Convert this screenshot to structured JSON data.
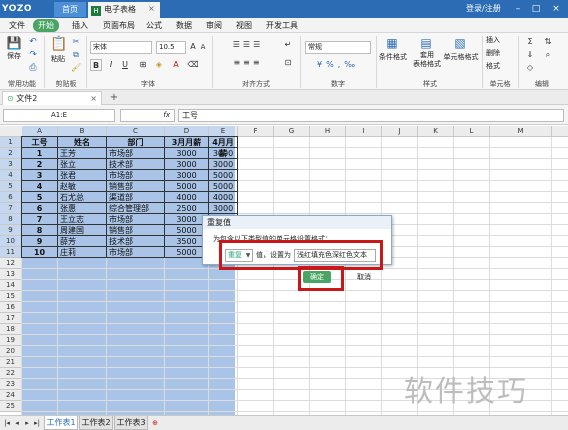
{
  "titlebar": {
    "logo": "YOZO",
    "home_tab": "首页",
    "doc_tab": "电子表格",
    "doc_tab_icon": "H",
    "login": "登录/注册"
  },
  "menu": [
    "文件",
    "开始",
    "插入",
    "页面布局",
    "公式",
    "数据",
    "审阅",
    "视图",
    "开发工具"
  ],
  "ribbon": {
    "save": "保存",
    "paste": "粘贴",
    "font_name": "宋体",
    "font_size": "10.5",
    "number_format": "常规",
    "conditional_format": "条件格式",
    "table_format": "套用\n表格格式",
    "cell_format": "单元格格式",
    "insert": "插入",
    "delete": "删除",
    "format": "格式",
    "bold": "B",
    "italic": "I",
    "underline": "U",
    "groups": [
      "常用功能",
      "剪贴板",
      "字体",
      "对齐方式",
      "数字",
      "样式",
      "单元格",
      "编辑"
    ]
  },
  "doc_tabrow": {
    "tab_label": "文件2",
    "tab_close": "×",
    "new_tab": "+"
  },
  "formula_bar": {
    "name_box": "A1:E",
    "fx": "fx",
    "content": "工号"
  },
  "grid": {
    "columns": [
      "A",
      "B",
      "C",
      "D",
      "E",
      "F",
      "G",
      "H",
      "I",
      "J",
      "K",
      "L",
      "M"
    ],
    "rows": [
      "1",
      "2",
      "3",
      "4",
      "5",
      "6",
      "7",
      "8",
      "9",
      "10",
      "11",
      "12",
      "13",
      "14",
      "15",
      "16",
      "17",
      "18",
      "19",
      "20",
      "21",
      "22",
      "23",
      "24",
      "25"
    ],
    "table_headers": [
      "工号",
      "姓名",
      "部门",
      "3月月薪",
      "4月月薪"
    ],
    "table_rows": [
      [
        "1",
        "王芳",
        "市场部",
        "3000",
        "3000"
      ],
      [
        "2",
        "张立",
        "技术部",
        "3000",
        "3000"
      ],
      [
        "3",
        "张君",
        "市场部",
        "3000",
        "5000"
      ],
      [
        "4",
        "赵敏",
        "销售部",
        "5000",
        "5000"
      ],
      [
        "5",
        "石尤总",
        "渠道部",
        "4000",
        "4000"
      ],
      [
        "6",
        "张惠",
        "综合管理部",
        "2500",
        "3000"
      ],
      [
        "7",
        "王立志",
        "市场部",
        "3000",
        "5000"
      ],
      [
        "8",
        "周建国",
        "销售部",
        "5000",
        "5000"
      ],
      [
        "9",
        "薛芳",
        "技术部",
        "3500",
        "5000"
      ],
      [
        "10",
        "庄莉",
        "市场部",
        "5000",
        ""
      ]
    ]
  },
  "sheets": {
    "tabs": [
      "工作表1",
      "工作表2",
      "工作表3"
    ],
    "active": "工作表1"
  },
  "dialog": {
    "title": "重复值",
    "prompt": "为包含以下类型值的单元格设置格式：",
    "condition": "重复",
    "value_label": "值，设置为",
    "format_option": "浅红填充色深红色文本",
    "ok": "确定",
    "cancel": "取消"
  },
  "watermark": "软件技巧",
  "colors": {
    "title_bar": "#2b6cb5",
    "accent_green": "#4aa564",
    "selection": "#a9c4e6",
    "highlight_red": "#c81818"
  }
}
